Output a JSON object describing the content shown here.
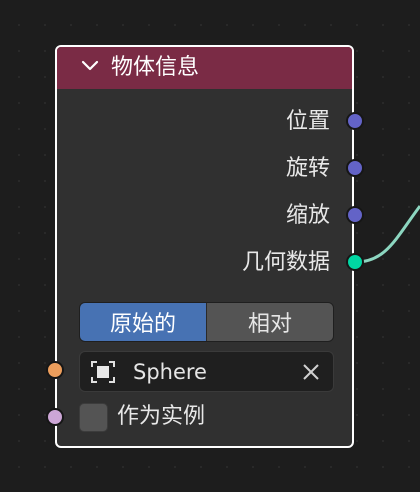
{
  "node": {
    "title": "物体信息",
    "collapse_icon": "chevron-down-icon",
    "header_color": "#7a2b45",
    "outputs": [
      {
        "label": "位置",
        "socket_type": "vector",
        "socket_color": "#6363c7"
      },
      {
        "label": "旋转",
        "socket_type": "vector",
        "socket_color": "#6363c7"
      },
      {
        "label": "缩放",
        "socket_type": "vector",
        "socket_color": "#6363c7"
      },
      {
        "label": "几何数据",
        "socket_type": "geometry",
        "socket_color": "#00d6a3"
      }
    ],
    "transform_space": {
      "options": [
        "原始的",
        "相对"
      ],
      "selected": "原始的"
    },
    "object_field": {
      "icon": "object-icon",
      "value": "Sphere",
      "clear_icon": "close-icon",
      "socket_color": "#ed9e5c"
    },
    "as_instance": {
      "label": "作为实例",
      "checked": false,
      "socket_color": "#cca6d6"
    }
  }
}
